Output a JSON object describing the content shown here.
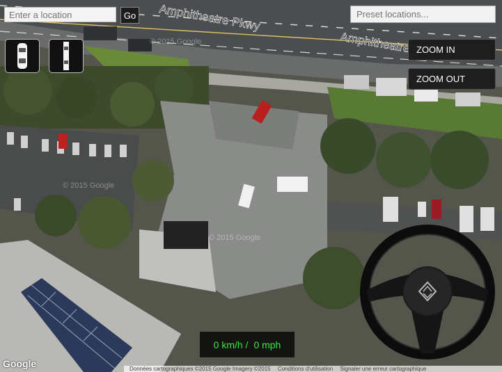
{
  "search": {
    "placeholder": "Enter a location",
    "go_label": "Go"
  },
  "presets": {
    "placeholder": "Preset locations..."
  },
  "vehicles": [
    {
      "icon": "car-icon"
    },
    {
      "icon": "bus-icon"
    }
  ],
  "zoom": {
    "in_label": "ZOOM IN",
    "out_label": "ZOOM OUT"
  },
  "speed": {
    "kmh": "0 km/h /",
    "mph": "0 mph"
  },
  "map": {
    "street_label_1": "Amphitheatre Pkwy",
    "street_label_2": "Amphitheatre Pkwy",
    "watermark_1": "© 2015 Google",
    "watermark_2": "© 2015 Google",
    "watermark_3": "© 2015 Google",
    "logo": "Google",
    "attribution": "Données cartographiques ©2015 Google Imagery ©2015",
    "terms": "Conditions d'utilisation",
    "report": "Signaler une erreur cartographique"
  },
  "colors": {
    "speed_text": "#38e838",
    "control_bg": "#1e1e1e"
  }
}
